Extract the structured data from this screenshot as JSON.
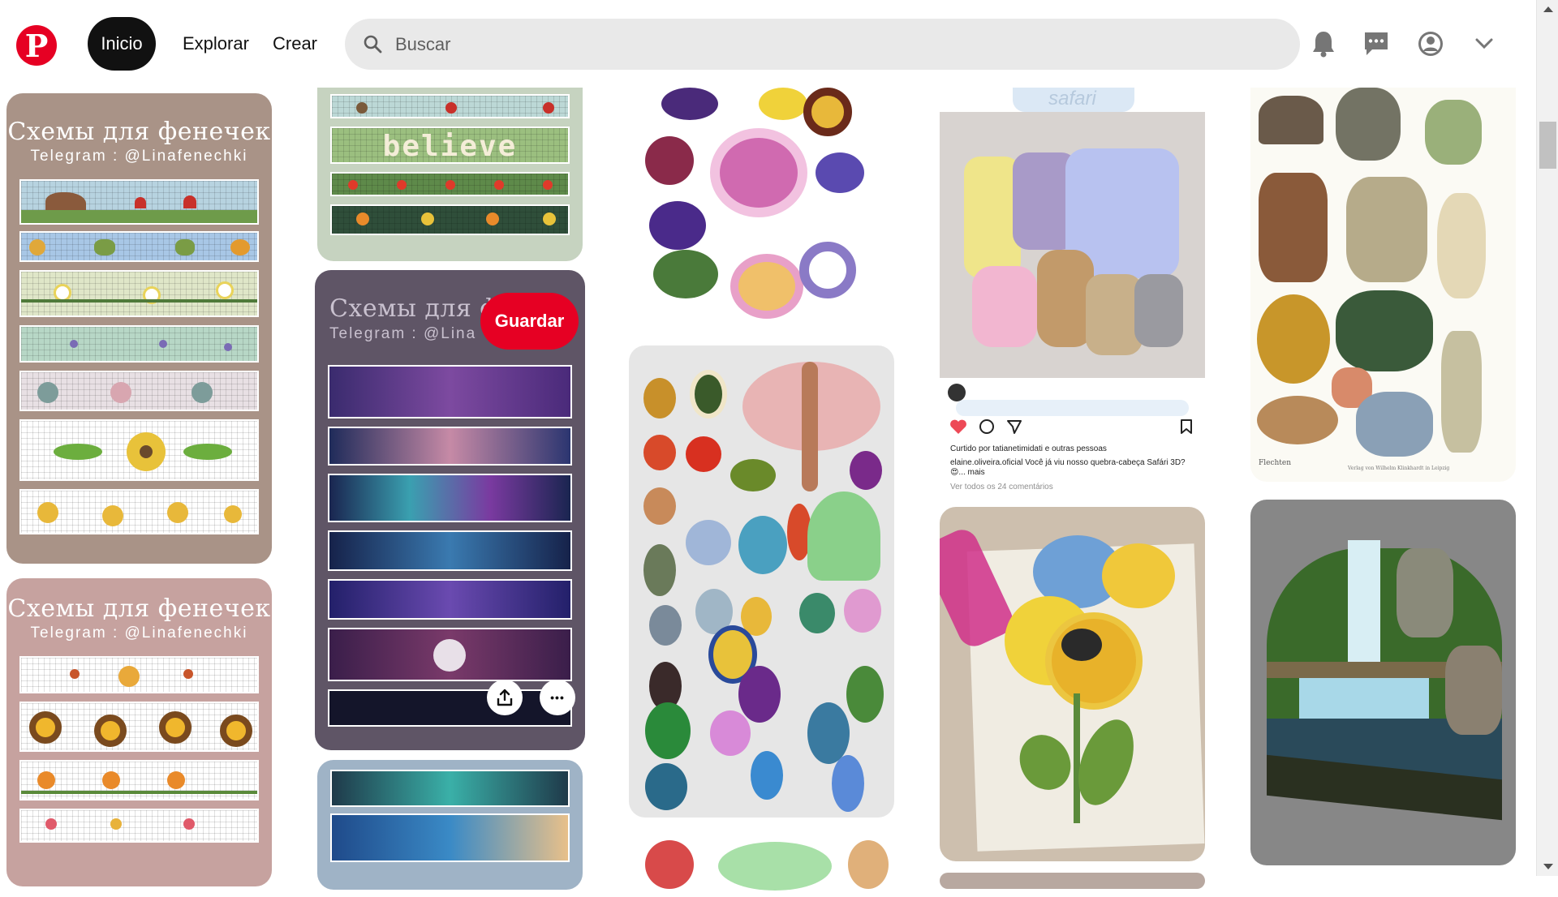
{
  "header": {
    "logo_letter": "P",
    "nav": {
      "home": "Inicio",
      "explore": "Explorar",
      "create": "Crear"
    },
    "search": {
      "placeholder": "Buscar",
      "value": ""
    },
    "icons": [
      "notifications-icon",
      "messages-icon",
      "profile-icon",
      "chevron-down-icon"
    ]
  },
  "pins": {
    "scheme_title": "Схемы для фенечек",
    "scheme_subtitle": "Telegram : @Linafenechki",
    "scheme_title_partial": "Схемы для ф",
    "scheme_subtitle_partial": "Telegram : @Lina",
    "believe_text": "believe",
    "safari_text": "safari",
    "save_label": "Guardar",
    "more_label": "•••"
  },
  "instagram": {
    "liked_by": "Curtido por tatianetimidati e outras pessoas",
    "caption": "elaine.oliveira.oficial Você já viu nosso quebra-cabeça Safári 3D? 😍... mais",
    "comments": "Ver todos os 24 comentários"
  },
  "plates": {
    "lichen_label": "Flechten",
    "lichen_publisher": "Verlag von Wilhelm Klinkhardt in Leipzig"
  },
  "colors": {
    "brand_red": "#e60023",
    "search_bg": "#e9e9e9",
    "scheme_card_1": "#a99387",
    "scheme_card_2": "#c6a29f",
    "scheme_card_3": "#5f5566"
  }
}
